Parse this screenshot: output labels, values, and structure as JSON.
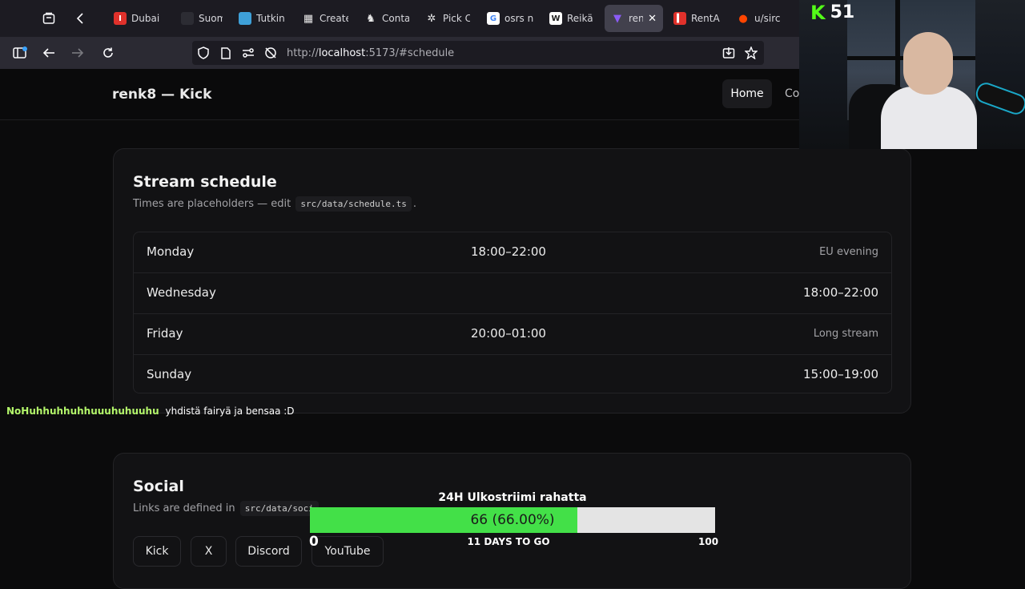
{
  "browser": {
    "tabs": [
      {
        "label": "Dubai",
        "icon": "red-square-icon",
        "color": "#e0312b"
      },
      {
        "label": "Suom",
        "icon": "dark-favicon-icon",
        "color": "#2c2c33"
      },
      {
        "label": "Tutkin",
        "icon": "blue-map-icon",
        "color": "#3ea0d8"
      },
      {
        "label": "Create",
        "icon": "grid-favicon-icon",
        "color": "#5a5a5a"
      },
      {
        "label": "Conta",
        "icon": "chess-knight-icon",
        "color": "#5a5a5a"
      },
      {
        "label": "Pick C",
        "icon": "pinwheel-icon",
        "color": "#5a5a5a"
      },
      {
        "label": "osrs n",
        "icon": "google-icon",
        "color": "#ffffff"
      },
      {
        "label": "Reikä",
        "icon": "wikipedia-icon",
        "color": "#ffffff"
      },
      {
        "label": "ren",
        "icon": "vite-icon",
        "color": "#8b5cf6",
        "active": true
      },
      {
        "label": "RentA",
        "icon": "red-bar-icon",
        "color": "#e0312b"
      },
      {
        "label": "u/sirc",
        "icon": "reddit-icon",
        "color": "#ff4500"
      }
    ],
    "url_prefix": "http://",
    "url_host": "localhost",
    "url_rest": ":5173/#schedule"
  },
  "site": {
    "title": "renk8 — Kick",
    "nav": {
      "home": "Home",
      "second": "Co"
    }
  },
  "schedule": {
    "title": "Stream schedule",
    "subtitle_before": "Times are placeholders — edit",
    "subtitle_code": "src/data/schedule.ts",
    "subtitle_after": ".",
    "rows": [
      {
        "day": "Monday",
        "time": "18:00–22:00",
        "note": "EU evening"
      },
      {
        "day": "Wednesday",
        "time": "18:00–22:00",
        "note": ""
      },
      {
        "day": "Friday",
        "time": "20:00–01:00",
        "note": "Long stream"
      },
      {
        "day": "Sunday",
        "time": "15:00–19:00",
        "note": ""
      }
    ]
  },
  "social": {
    "title": "Social",
    "subtitle_before": "Links are defined in",
    "subtitle_code": "src/data/soci",
    "buttons": [
      "Kick",
      "X",
      "Discord",
      "YouTube"
    ]
  },
  "overlay": {
    "viewer_count": "51",
    "kick_logo": "K",
    "chat": {
      "user": "NoHuhhuhhuhhuuuhuhuuhu",
      "message": "yhdistä fairyä ja bensaa :D"
    },
    "goal": {
      "title": "24H Ulkostriimi rahatta",
      "value_text": "66 (66.00%)",
      "progress": 0.66,
      "min": "0",
      "max": "100",
      "days_left": "11 DAYS TO GO",
      "fill_color": "#43e048"
    }
  }
}
